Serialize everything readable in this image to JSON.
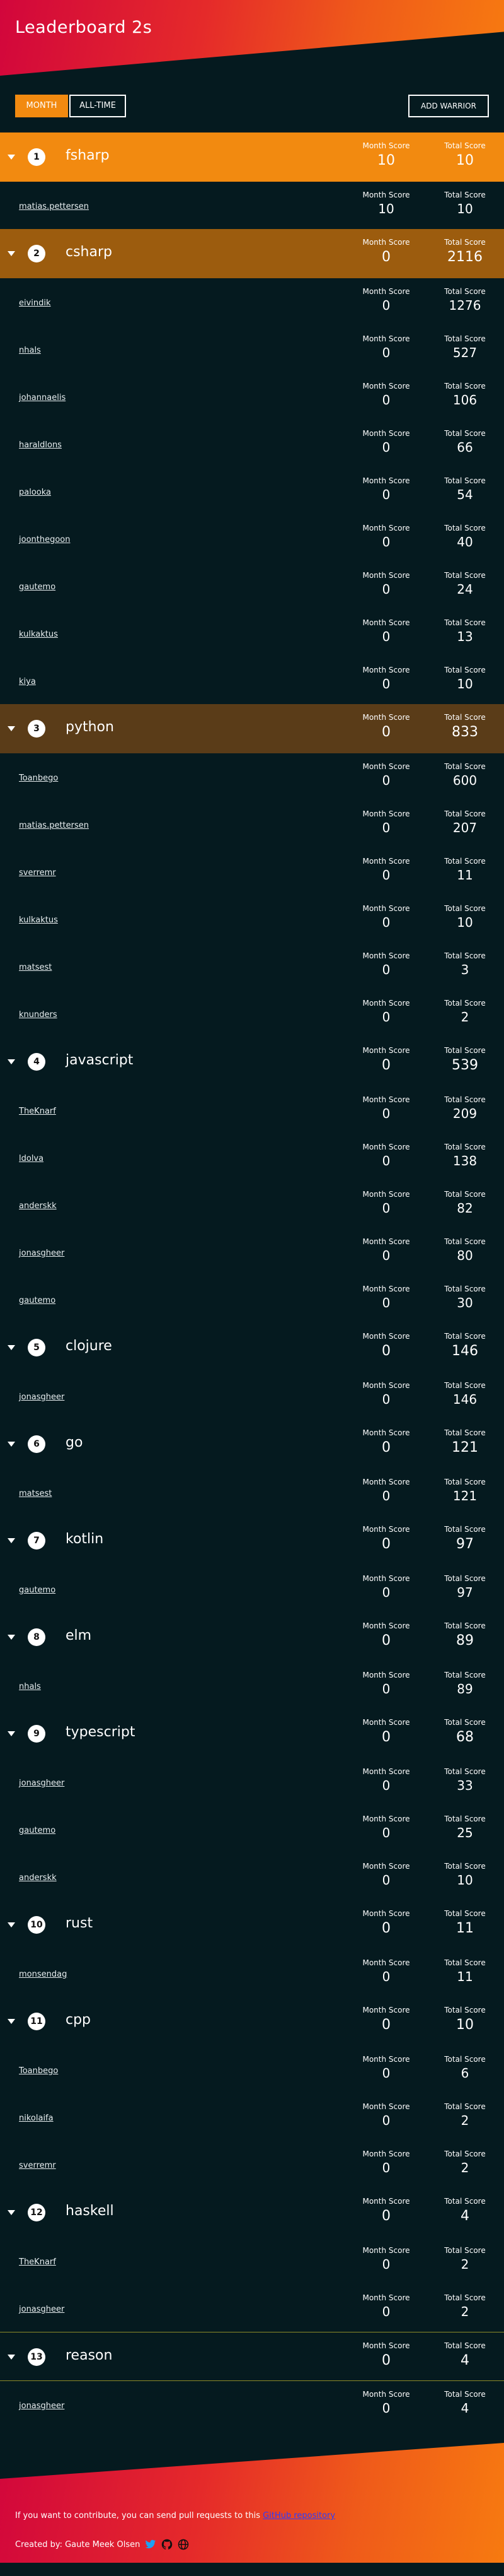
{
  "header": {
    "title": "Leaderboard 2s"
  },
  "controls": {
    "month": "MONTH",
    "alltime": "ALL-TIME",
    "add_warrior": "ADD WARRIOR"
  },
  "labels": {
    "month_score": "Month Score",
    "total_score": "Total Score"
  },
  "colors": {
    "accent": "#f28a10",
    "background": "#051a1f",
    "gradient_start": "#d2063c",
    "gradient_end": "#f77a10"
  },
  "languages": [
    {
      "rank": "1",
      "name": "fsharp",
      "month": "10",
      "total": "10",
      "users": [
        {
          "name": "matias.pettersen",
          "month": "10",
          "total": "10"
        }
      ]
    },
    {
      "rank": "2",
      "name": "csharp",
      "month": "0",
      "total": "2116",
      "users": [
        {
          "name": "eivindik",
          "month": "0",
          "total": "1276"
        },
        {
          "name": "nhals",
          "month": "0",
          "total": "527"
        },
        {
          "name": "johannaelis",
          "month": "0",
          "total": "106"
        },
        {
          "name": "haraldlons",
          "month": "0",
          "total": "66"
        },
        {
          "name": "palooka",
          "month": "0",
          "total": "54"
        },
        {
          "name": "joonthegoon",
          "month": "0",
          "total": "40"
        },
        {
          "name": "gautemo",
          "month": "0",
          "total": "24"
        },
        {
          "name": "kulkaktus",
          "month": "0",
          "total": "13"
        },
        {
          "name": "kiya",
          "month": "0",
          "total": "10"
        }
      ]
    },
    {
      "rank": "3",
      "name": "python",
      "month": "0",
      "total": "833",
      "users": [
        {
          "name": "Toanbego",
          "month": "0",
          "total": "600"
        },
        {
          "name": "matias.pettersen",
          "month": "0",
          "total": "207"
        },
        {
          "name": "sverremr",
          "month": "0",
          "total": "11"
        },
        {
          "name": "kulkaktus",
          "month": "0",
          "total": "10"
        },
        {
          "name": "matsest",
          "month": "0",
          "total": "3"
        },
        {
          "name": "knunders",
          "month": "0",
          "total": "2"
        }
      ]
    },
    {
      "rank": "4",
      "name": "javascript",
      "month": "0",
      "total": "539",
      "users": [
        {
          "name": "TheKnarf",
          "month": "0",
          "total": "209"
        },
        {
          "name": "ldolva",
          "month": "0",
          "total": "138"
        },
        {
          "name": "anderskk",
          "month": "0",
          "total": "82"
        },
        {
          "name": "jonasgheer",
          "month": "0",
          "total": "80"
        },
        {
          "name": "gautemo",
          "month": "0",
          "total": "30"
        }
      ]
    },
    {
      "rank": "5",
      "name": "clojure",
      "month": "0",
      "total": "146",
      "users": [
        {
          "name": "jonasgheer",
          "month": "0",
          "total": "146"
        }
      ]
    },
    {
      "rank": "6",
      "name": "go",
      "month": "0",
      "total": "121",
      "users": [
        {
          "name": "matsest",
          "month": "0",
          "total": "121"
        }
      ]
    },
    {
      "rank": "7",
      "name": "kotlin",
      "month": "0",
      "total": "97",
      "users": [
        {
          "name": "gautemo",
          "month": "0",
          "total": "97"
        }
      ]
    },
    {
      "rank": "8",
      "name": "elm",
      "month": "0",
      "total": "89",
      "users": [
        {
          "name": "nhals",
          "month": "0",
          "total": "89"
        }
      ]
    },
    {
      "rank": "9",
      "name": "typescript",
      "month": "0",
      "total": "68",
      "users": [
        {
          "name": "jonasgheer",
          "month": "0",
          "total": "33"
        },
        {
          "name": "gautemo",
          "month": "0",
          "total": "25"
        },
        {
          "name": "anderskk",
          "month": "0",
          "total": "10"
        }
      ]
    },
    {
      "rank": "10",
      "name": "rust",
      "month": "0",
      "total": "11",
      "users": [
        {
          "name": "monsendag",
          "month": "0",
          "total": "11"
        }
      ]
    },
    {
      "rank": "11",
      "name": "cpp",
      "month": "0",
      "total": "10",
      "users": [
        {
          "name": "Toanbego",
          "month": "0",
          "total": "6"
        },
        {
          "name": "nikolaifa",
          "month": "0",
          "total": "2"
        },
        {
          "name": "sverremr",
          "month": "0",
          "total": "2"
        }
      ]
    },
    {
      "rank": "12",
      "name": "haskell",
      "month": "0",
      "total": "4",
      "users": [
        {
          "name": "TheKnarf",
          "month": "0",
          "total": "2"
        },
        {
          "name": "jonasgheer",
          "month": "0",
          "total": "2"
        }
      ]
    },
    {
      "rank": "13",
      "name": "reason",
      "month": "0",
      "total": "4",
      "users": [
        {
          "name": "jonasgheer",
          "month": "0",
          "total": "4"
        }
      ]
    }
  ],
  "footer": {
    "contribute_text": "If you want to contribute, you can send pull requests to this ",
    "repo_link": "GitHub repository",
    "created_by": "Created by: Gaute Meek Olsen",
    "icons": [
      "twitter-icon",
      "github-icon",
      "globe-icon"
    ]
  }
}
